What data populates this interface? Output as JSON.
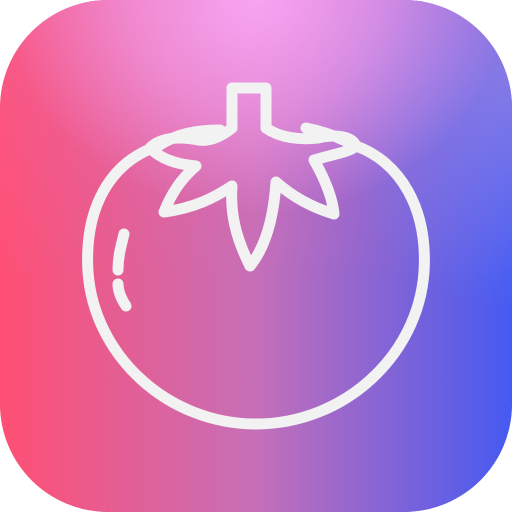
{
  "icon": {
    "name": "tomato-icon",
    "gradient_colors": {
      "top_left": "#ee6fb6",
      "top_center": "#fba8f6",
      "top_right": "#6a86f7",
      "bottom_left": "#ff4f73",
      "bottom_center": "#c66fb8",
      "bottom_right": "#455af2"
    },
    "stroke_color": "#f2f2f2"
  }
}
